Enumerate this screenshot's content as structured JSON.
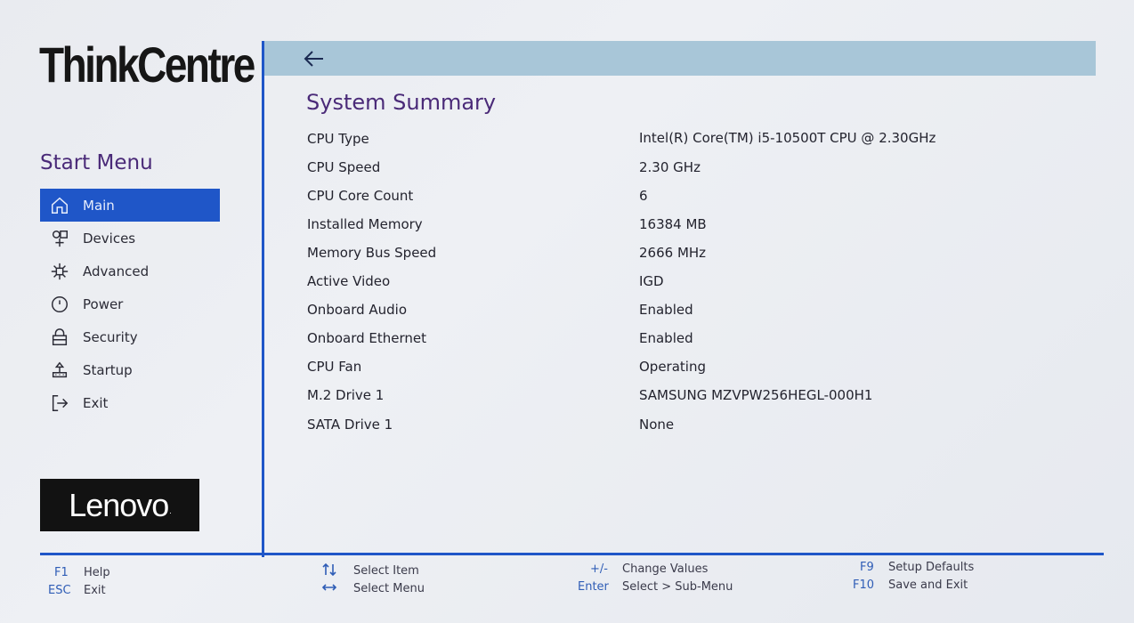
{
  "brand": {
    "product": "ThinkCentre",
    "vendor_logo": "Lenovo",
    "vendor_mark": "."
  },
  "sidebar": {
    "title": "Start Menu",
    "items": [
      {
        "label": "Main",
        "icon": "home-icon",
        "active": true
      },
      {
        "label": "Devices",
        "icon": "devices-icon",
        "active": false
      },
      {
        "label": "Advanced",
        "icon": "advanced-chip-icon",
        "active": false
      },
      {
        "label": "Power",
        "icon": "power-icon",
        "active": false
      },
      {
        "label": "Security",
        "icon": "lock-icon",
        "active": false
      },
      {
        "label": "Startup",
        "icon": "startup-icon",
        "active": false
      },
      {
        "label": "Exit",
        "icon": "exit-icon",
        "active": false
      }
    ]
  },
  "main": {
    "back_icon": "back-arrow-icon",
    "title": "System Summary",
    "rows": [
      {
        "label": "CPU Type",
        "value": "Intel(R) Core(TM) i5-10500T CPU @ 2.30GHz"
      },
      {
        "label": "CPU Speed",
        "value": "2.30 GHz"
      },
      {
        "label": "CPU Core Count",
        "value": "6"
      },
      {
        "label": "Installed Memory",
        "value": "16384 MB"
      },
      {
        "label": "Memory Bus Speed",
        "value": "2666 MHz"
      },
      {
        "label": "Active Video",
        "value": "IGD"
      },
      {
        "label": "Onboard Audio",
        "value": "Enabled"
      },
      {
        "label": "Onboard Ethernet",
        "value": "Enabled"
      },
      {
        "label": "CPU Fan",
        "value": "Operating"
      },
      {
        "label": "M.2 Drive 1",
        "value": "SAMSUNG MZVPW256HEGL-000H1"
      },
      {
        "label": "SATA Drive 1",
        "value": "None"
      }
    ]
  },
  "footer": {
    "f1_key": "F1",
    "f1_label": "Help",
    "esc_key": "ESC",
    "esc_label": "Exit",
    "updown_label": "Select Item",
    "leftright_label": "Select Menu",
    "plusminus_key": "+/-",
    "plusminus_label": "Change Values",
    "enter_key": "Enter",
    "enter_label": "Select > Sub-Menu",
    "f9_key": "F9",
    "f9_label": "Setup Defaults",
    "f10_key": "F10",
    "f10_label": "Save and Exit"
  },
  "colors": {
    "accent": "#1f56c8",
    "title": "#4a2a78",
    "topbar": "#a8c6d8",
    "brand_dot": "#e4312b"
  }
}
